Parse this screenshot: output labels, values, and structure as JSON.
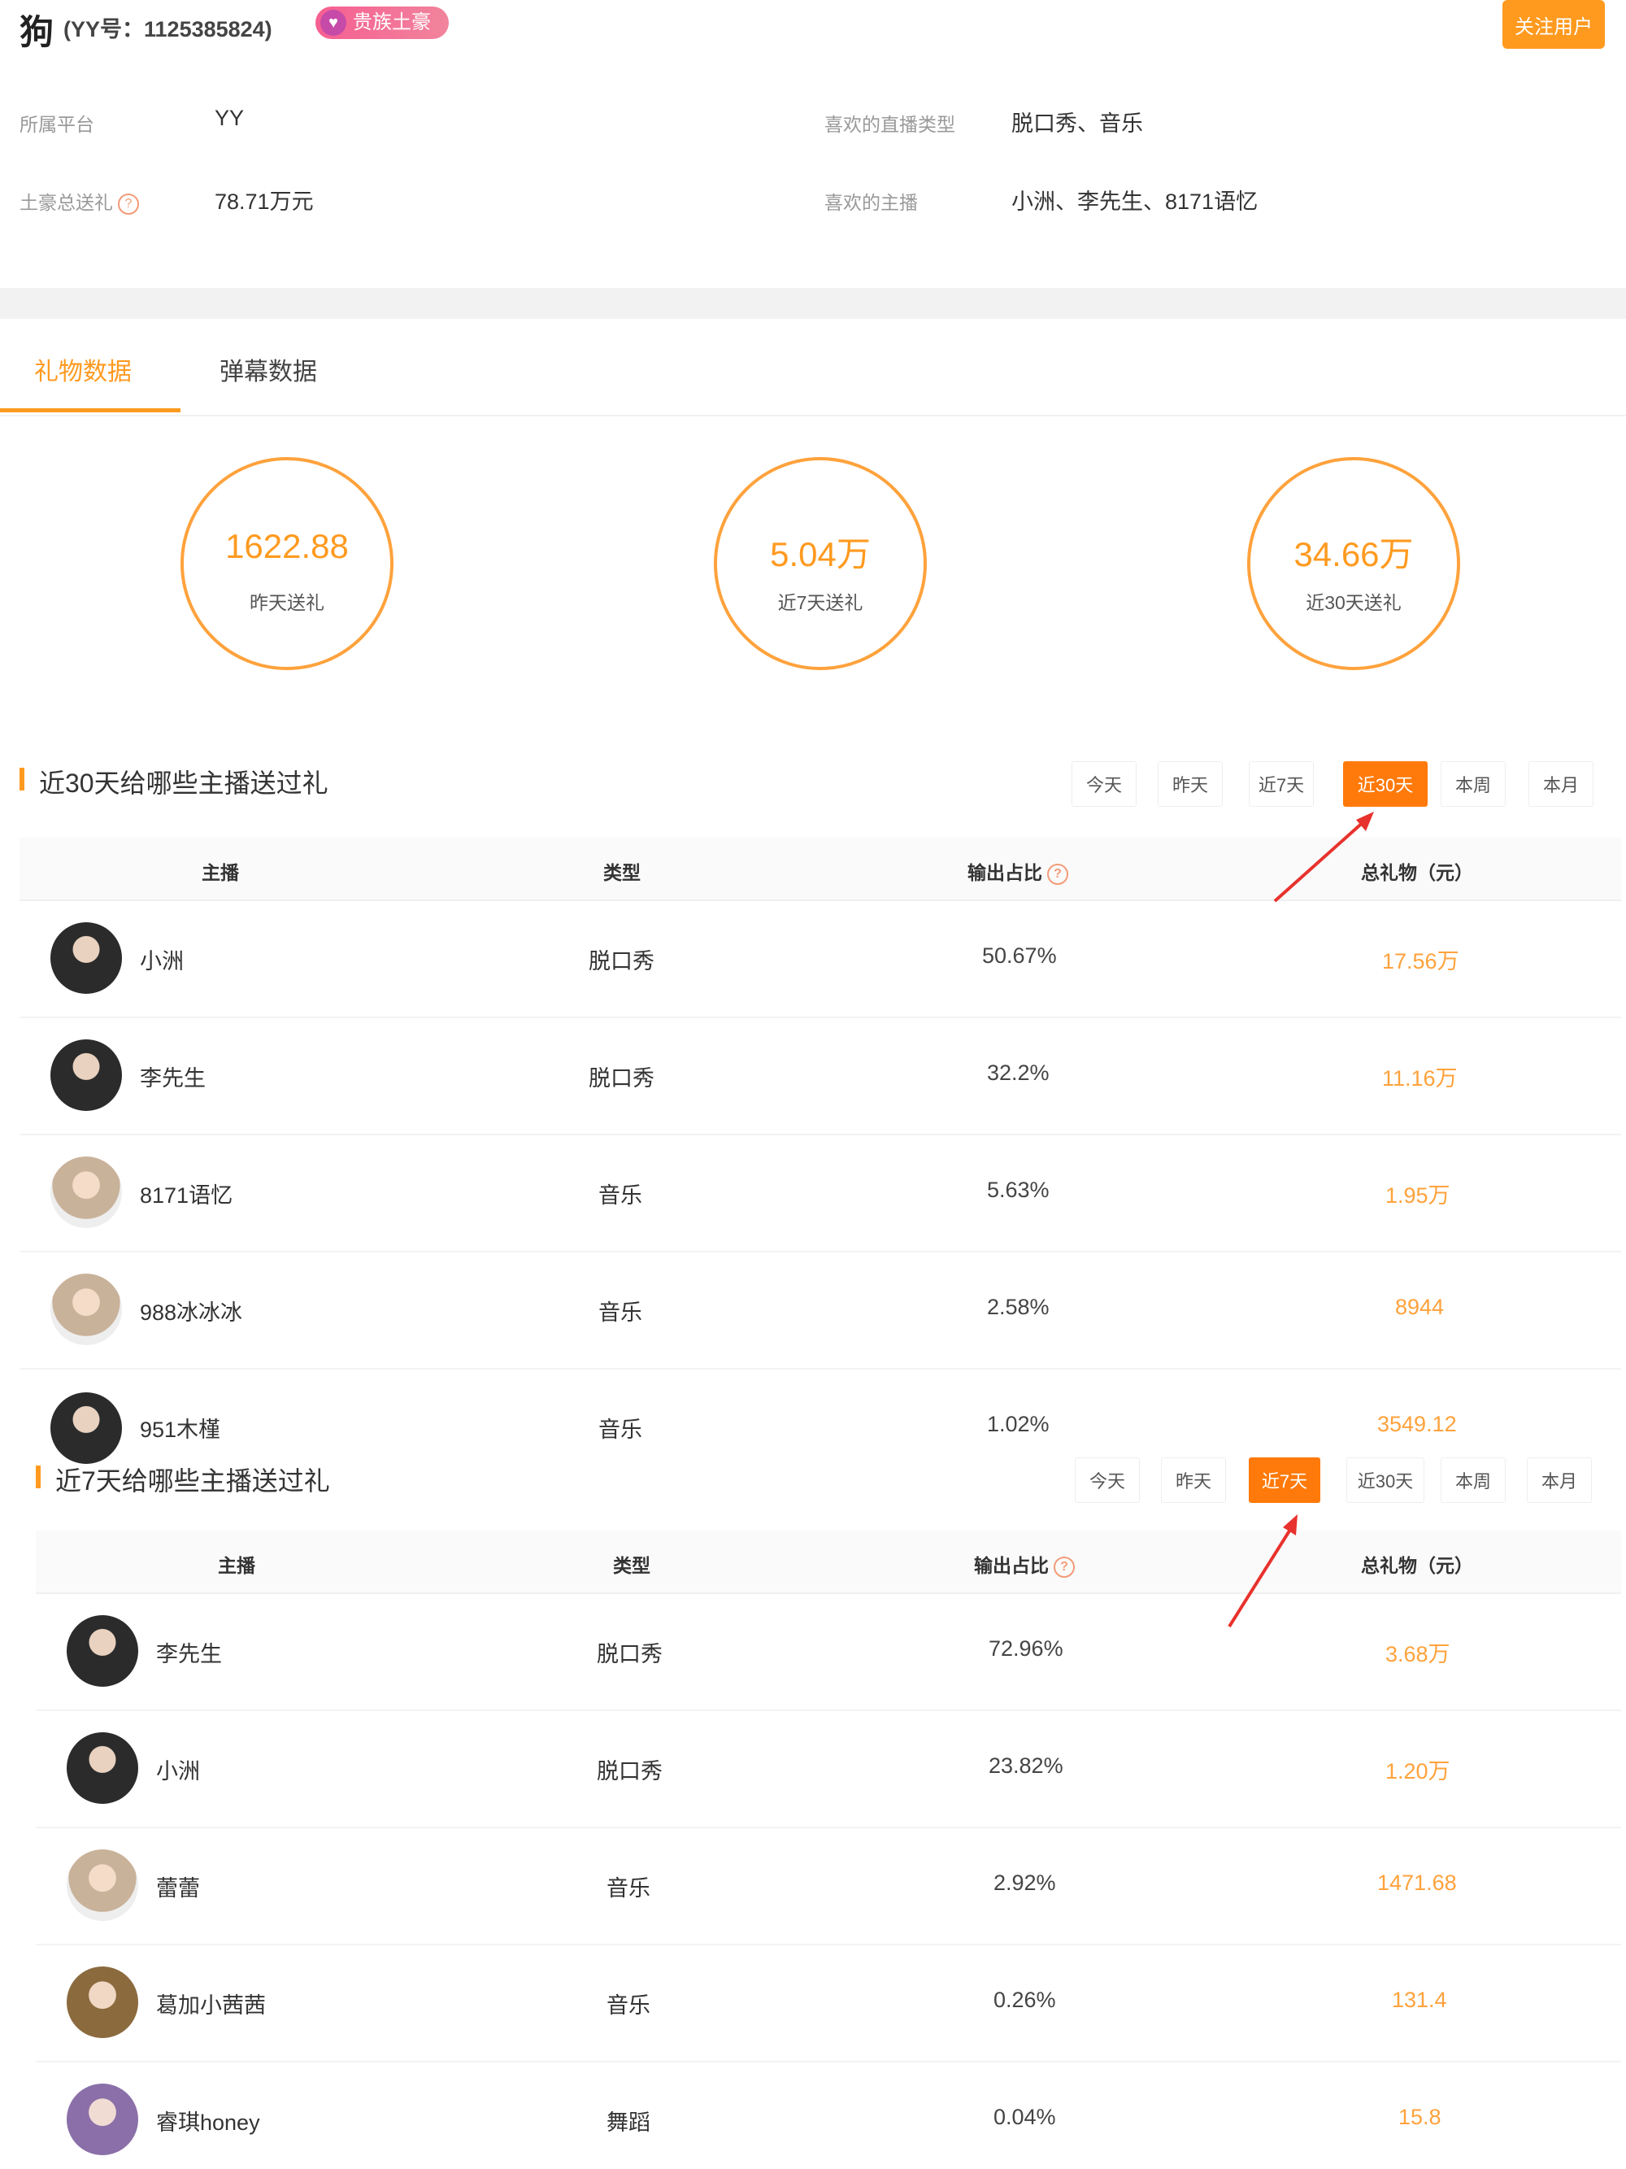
{
  "header": {
    "user_name": "狗",
    "user_id": "(YY号：1125385824)",
    "badge": "贵族土豪",
    "follow_button": "关注用户",
    "info": {
      "platform_label": "所属平台",
      "platform_value": "YY",
      "total_label": "土豪总送礼",
      "total_value": "78.71万元",
      "type_label": "喜欢的直播类型",
      "type_value": "脱口秀、音乐",
      "anchor_label": "喜欢的主播",
      "anchor_value": "小洲、李先生、8171语忆"
    }
  },
  "tabs": [
    {
      "label": "礼物数据"
    },
    {
      "label": "弹幕数据"
    }
  ],
  "stats": [
    {
      "value": "1622.88",
      "label": "昨天送礼"
    },
    {
      "value": "5.04万",
      "label": "近7天送礼"
    },
    {
      "value": "34.66万",
      "label": "近30天送礼"
    }
  ],
  "table30": {
    "title": "近30天给哪些主播送过礼",
    "filters": [
      "今天",
      "昨天",
      "近7天",
      "近30天",
      "本周",
      "本月"
    ],
    "active_filter": "近30天",
    "columns": [
      "主播",
      "类型",
      "输出占比",
      "总礼物（元）"
    ],
    "rows": [
      {
        "name": "小洲",
        "type": "脱口秀",
        "pct": "50.67%",
        "amount": "17.56万"
      },
      {
        "name": "李先生",
        "type": "脱口秀",
        "pct": "32.2%",
        "amount": "11.16万"
      },
      {
        "name": "8171语忆",
        "type": "音乐",
        "pct": "5.63%",
        "amount": "1.95万"
      },
      {
        "name": "988冰冰冰",
        "type": "音乐",
        "pct": "2.58%",
        "amount": "8944"
      },
      {
        "name": "951木槿",
        "type": "音乐",
        "pct": "1.02%",
        "amount": "3549.12"
      }
    ]
  },
  "table7": {
    "title": "近7天给哪些主播送过礼",
    "filters": [
      "今天",
      "昨天",
      "近7天",
      "近30天",
      "本周",
      "本月"
    ],
    "active_filter": "近7天",
    "columns": [
      "主播",
      "类型",
      "输出占比",
      "总礼物（元）"
    ],
    "rows": [
      {
        "name": "李先生",
        "type": "脱口秀",
        "pct": "72.96%",
        "amount": "3.68万"
      },
      {
        "name": "小洲",
        "type": "脱口秀",
        "pct": "23.82%",
        "amount": "1.20万"
      },
      {
        "name": "蕾蕾",
        "type": "音乐",
        "pct": "2.92%",
        "amount": "1471.68"
      },
      {
        "name": "葛加小茜茜",
        "type": "音乐",
        "pct": "0.26%",
        "amount": "131.4"
      },
      {
        "name": "睿琪honey",
        "type": "舞蹈",
        "pct": "0.04%",
        "amount": "15.8"
      }
    ]
  },
  "colors": {
    "accent": "#ff9a1f",
    "active_filter": "#ff7a0a",
    "badge": "#f65e92",
    "arrow": "#e8322d"
  }
}
